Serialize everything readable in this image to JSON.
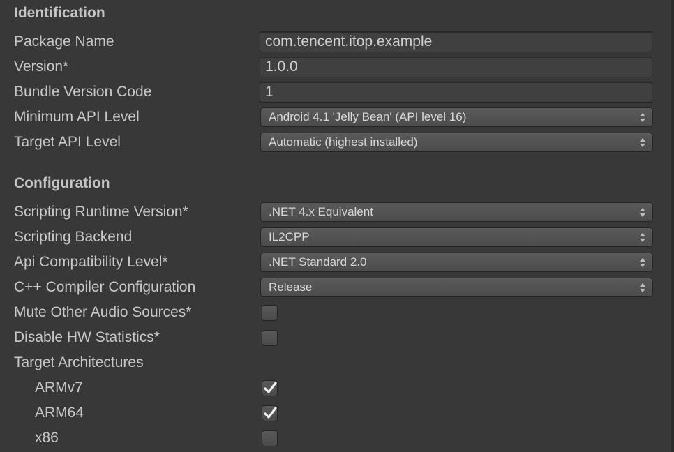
{
  "identification": {
    "header": "Identification",
    "package_name_label": "Package Name",
    "package_name_value": "com.tencent.itop.example",
    "version_label": "Version*",
    "version_value": "1.0.0",
    "bundle_version_code_label": "Bundle Version Code",
    "bundle_version_code_value": "1",
    "min_api_label": "Minimum API Level",
    "min_api_value": "Android 4.1 'Jelly Bean' (API level 16)",
    "target_api_label": "Target API Level",
    "target_api_value": "Automatic (highest installed)"
  },
  "configuration": {
    "header": "Configuration",
    "scripting_runtime_label": "Scripting Runtime Version*",
    "scripting_runtime_value": ".NET 4.x Equivalent",
    "scripting_backend_label": "Scripting Backend",
    "scripting_backend_value": "IL2CPP",
    "api_compat_label": "Api Compatibility Level*",
    "api_compat_value": ".NET Standard 2.0",
    "cpp_compiler_label": "C++ Compiler Configuration",
    "cpp_compiler_value": "Release",
    "mute_audio_label": "Mute Other Audio Sources*",
    "mute_audio_checked": false,
    "disable_hw_label": "Disable HW Statistics*",
    "disable_hw_checked": false,
    "target_arch_label": "Target Architectures",
    "architectures": [
      {
        "label": "ARMv7",
        "checked": true
      },
      {
        "label": "ARM64",
        "checked": true
      },
      {
        "label": "x86",
        "checked": false
      }
    ]
  },
  "icons": {
    "dropdown_arrow": "updown-arrow-icon",
    "checkmark": "checkmark-icon"
  },
  "colors": {
    "background": "#383838",
    "text": "#c8c8c8",
    "field_bg": "#404040",
    "dropdown_bg": "#525252",
    "border": "#232323"
  }
}
